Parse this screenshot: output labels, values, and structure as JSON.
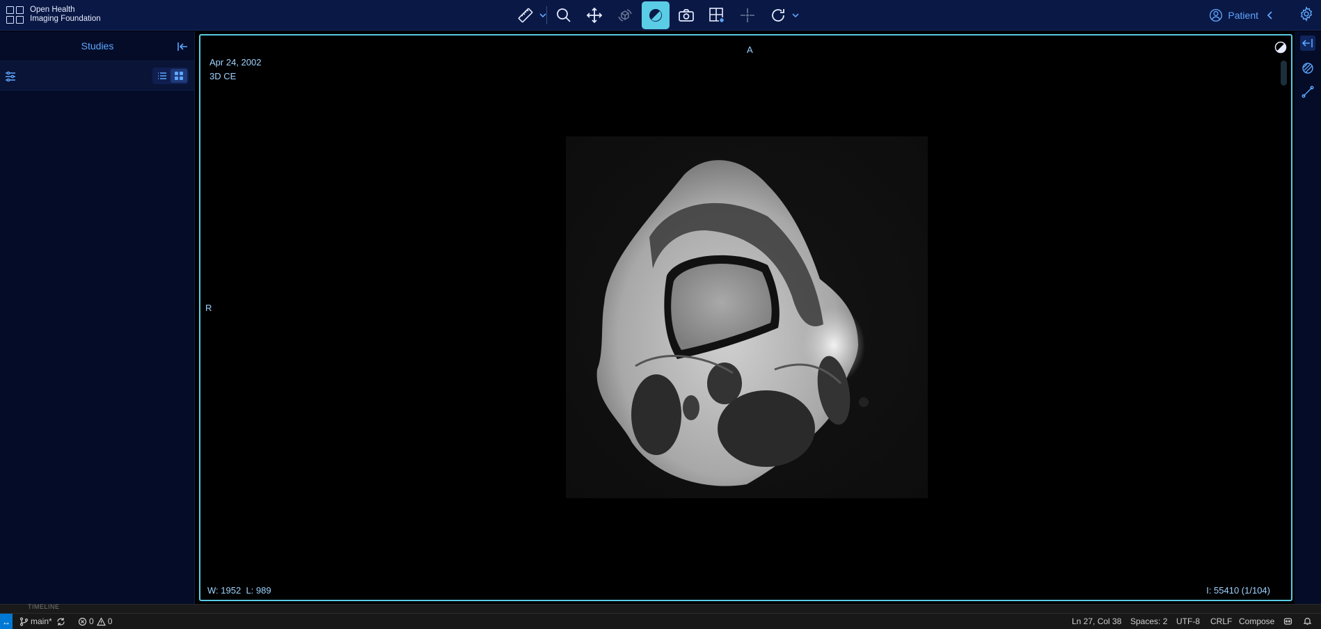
{
  "app": {
    "logo_line1": "Open Health",
    "logo_line2": "Imaging Foundation"
  },
  "toolbar": {
    "tools": [
      {
        "name": "measure-tool",
        "icon": "ruler-icon",
        "active": false,
        "dropdown": true
      },
      {
        "name": "zoom-tool",
        "icon": "magnifier-icon",
        "active": false
      },
      {
        "name": "pan-tool",
        "icon": "move-arrows-icon",
        "active": false
      },
      {
        "name": "rotate-3d-tool",
        "icon": "cube-rotate-icon",
        "active": false,
        "dimmed": true
      },
      {
        "name": "window-level-tool",
        "icon": "contrast-icon",
        "active": true
      },
      {
        "name": "capture-tool",
        "icon": "camera-icon",
        "active": false
      },
      {
        "name": "layout-tool",
        "icon": "grid-settings-icon",
        "active": false
      },
      {
        "name": "crosshairs-tool",
        "icon": "crosshair-icon",
        "active": false,
        "dimmed": true
      },
      {
        "name": "reset-tool",
        "icon": "rotate-cw-icon",
        "active": false,
        "dropdown": true
      }
    ],
    "accent": "#5acce6"
  },
  "header": {
    "patient_label": "Patient"
  },
  "left_panel": {
    "title": "Studies"
  },
  "viewport": {
    "date": "Apr 24, 2002",
    "series": "3D CE",
    "orientation_top": "A",
    "orientation_left": "R",
    "window_label": "W:",
    "window_value": "1952",
    "level_label": "L:",
    "level_value": "989",
    "instance": "I: 55410 (1/104)",
    "overlay_color": "#9fd4ff"
  },
  "timeline": {
    "label": "TIMELINE"
  },
  "statusbar": {
    "branch": "main*",
    "errors": "0",
    "warnings": "0",
    "position": "Ln 27, Col 38",
    "spaces": "Spaces: 2",
    "encoding": "UTF-8",
    "eol": "CRLF",
    "language": "Compose"
  }
}
